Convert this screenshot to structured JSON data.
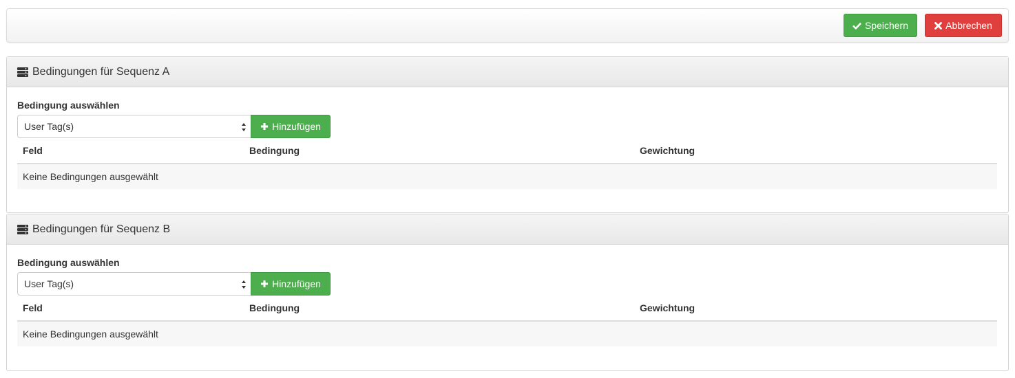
{
  "toolbar": {
    "save_label": "Speichern",
    "cancel_label": "Abbrechen"
  },
  "panels": [
    {
      "title": "Bedingungen für Sequenz A",
      "select_label": "Bedingung auswählen",
      "select_value": "User Tag(s)",
      "add_label": "Hinzufügen",
      "columns": [
        "Feld",
        "Bedingung",
        "Gewichtung"
      ],
      "empty_text": "Keine Bedingungen ausgewählt"
    },
    {
      "title": "Bedingungen für Sequenz B",
      "select_label": "Bedingung auswählen",
      "select_value": "User Tag(s)",
      "add_label": "Hinzufügen",
      "columns": [
        "Feld",
        "Bedingung",
        "Gewichtung"
      ],
      "empty_text": "Keine Bedingungen ausgewählt"
    }
  ],
  "icons": {
    "save": "check-icon",
    "cancel": "times-icon",
    "panel": "server-icon",
    "add": "plus-icon",
    "select": "select-arrows-icon"
  },
  "colors": {
    "success": "#4cae4c",
    "danger": "#e0403d",
    "panel_heading": "#ececec"
  }
}
